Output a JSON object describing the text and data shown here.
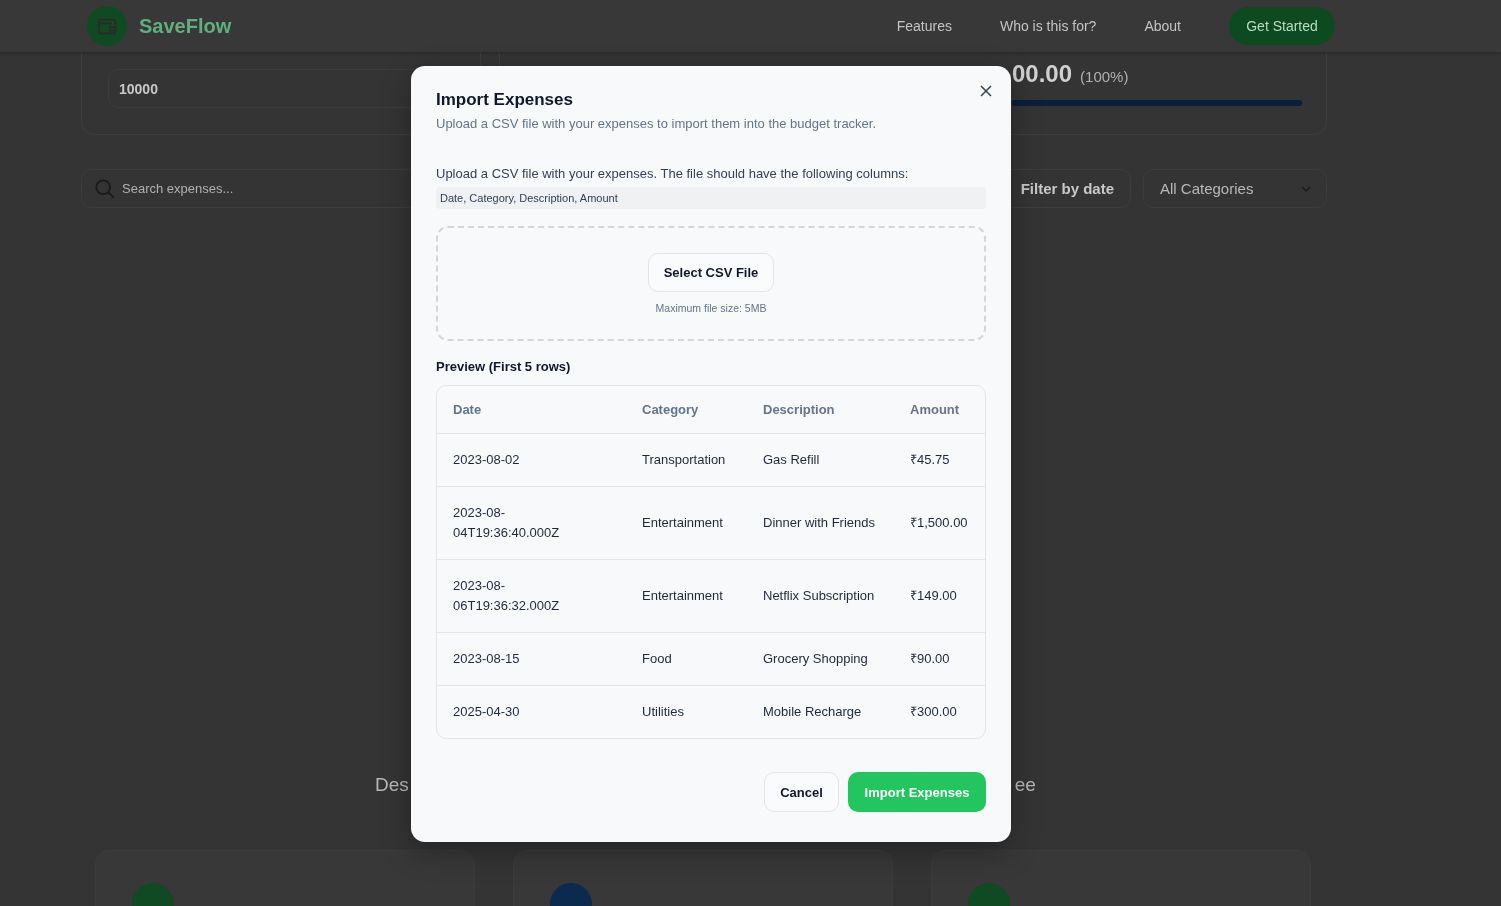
{
  "header": {
    "brand": "SaveFlow",
    "nav": [
      "Features",
      "Who is this for?",
      "About"
    ],
    "cta": "Get Started"
  },
  "budget": {
    "input_value": "10000",
    "amount": "00.00",
    "percent": "(100%)",
    "level": 1
  },
  "filters": {
    "search_placeholder": "Search expenses...",
    "date_button": "Filter by date",
    "category": "All Categories"
  },
  "section_fragments": [
    "Des",
    "ee"
  ],
  "feature_cards": [
    {
      "color": "#0f4a22"
    },
    {
      "color": "#0b2a4d"
    },
    {
      "color": "#0f4a22"
    }
  ],
  "modal": {
    "title": "Import Expenses",
    "subtitle": "Upload a CSV file with your expenses to import them into the budget tracker.",
    "instructions": "Upload a CSV file with your expenses. The file should have the following columns:",
    "columns_hint": "Date, Category, Description, Amount",
    "select_button": "Select CSV File",
    "max_size": "Maximum file size: 5MB",
    "preview_title": "Preview (First 5 rows)",
    "table": {
      "columns": [
        "Date",
        "Category",
        "Description",
        "Amount"
      ],
      "rows": [
        [
          "2023-08-02",
          "Transportation",
          "Gas Refill",
          "₹45.75"
        ],
        [
          "2023-08-04T19:36:40.000Z",
          "Entertainment",
          "Dinner with Friends",
          "₹1,500.00"
        ],
        [
          "2023-08-06T19:36:32.000Z",
          "Entertainment",
          "Netflix Subscription",
          "₹149.00"
        ],
        [
          "2023-08-15",
          "Food",
          "Grocery Shopping",
          "₹90.00"
        ],
        [
          "2025-04-30",
          "Utilities",
          "Mobile Recharge",
          "₹300.00"
        ]
      ]
    },
    "buttons": {
      "cancel": "Cancel",
      "import": "Import Expenses"
    }
  }
}
